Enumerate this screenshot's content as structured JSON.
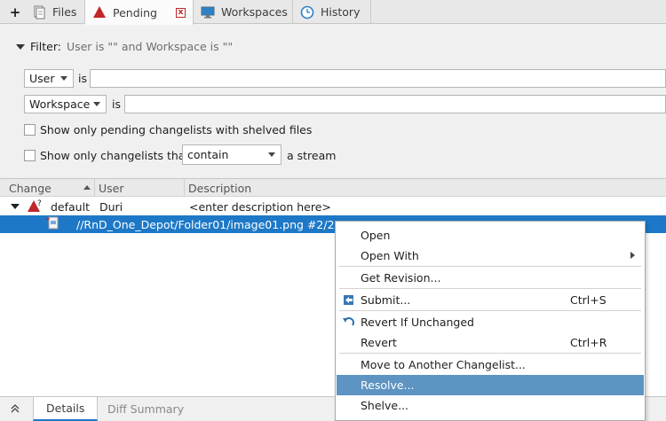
{
  "tabs": {
    "add": "+",
    "files": "Files",
    "pending": "Pending",
    "workspaces": "Workspaces",
    "history": "History",
    "close": "x"
  },
  "filter": {
    "label": "Filter:",
    "summary": "User is \"\" and Workspace is \"\"",
    "user_combo": "User",
    "user_is": "is",
    "user_value": "",
    "workspace_combo": "Workspace",
    "workspace_is": "is",
    "workspace_value": "",
    "shelved_label": "Show only pending changelists with shelved files",
    "stream_label": "Show only changelists that",
    "stream_mode": "contain",
    "stream_suffix": "a stream"
  },
  "table": {
    "columns": {
      "change": "Change",
      "user": "User",
      "description": "Description"
    },
    "rows": [
      {
        "change": "default",
        "user": "Duri",
        "description": "<enter description here>"
      }
    ],
    "file": "//RnD_One_Depot/Folder01/image01.png #2/2"
  },
  "bottom_tabs": {
    "details": "Details",
    "diff_summary": "Diff Summary"
  },
  "menu": {
    "items": [
      {
        "label": "Open",
        "shortcut": ""
      },
      {
        "label": "Open With",
        "shortcut": ""
      },
      {
        "label": "Get Revision...",
        "shortcut": ""
      },
      {
        "label": "Submit...",
        "shortcut": "Ctrl+S"
      },
      {
        "label": "Revert If Unchanged",
        "shortcut": ""
      },
      {
        "label": "Revert",
        "shortcut": "Ctrl+R"
      },
      {
        "label": "Move to Another Changelist...",
        "shortcut": ""
      },
      {
        "label": "Resolve...",
        "shortcut": ""
      },
      {
        "label": "Shelve...",
        "shortcut": ""
      }
    ]
  },
  "colors": {
    "accent": "#1d78c7",
    "menu_highlight": "#5e94c2",
    "pending_red": "#c0262a"
  }
}
